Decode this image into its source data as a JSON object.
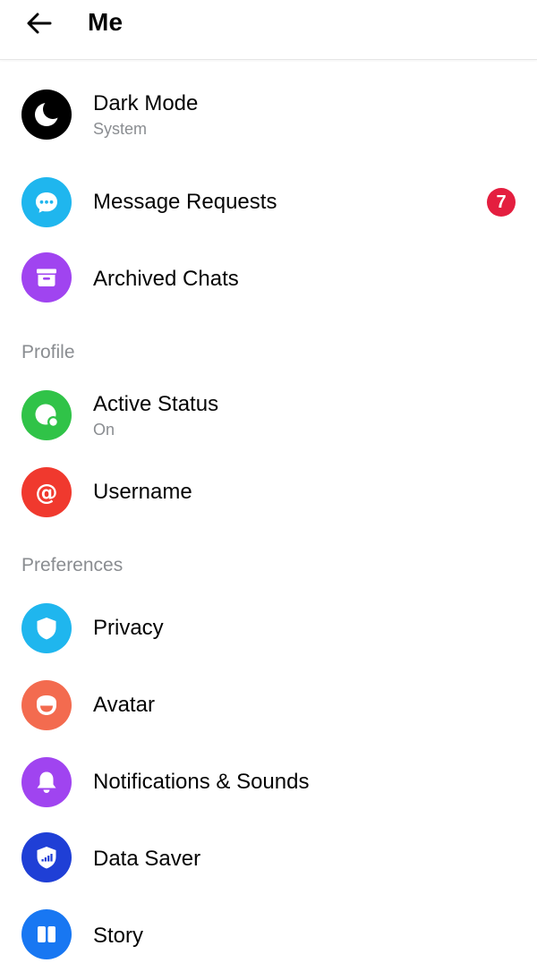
{
  "header": {
    "title": "Me",
    "back_icon": "back-arrow-icon"
  },
  "top_items": [
    {
      "label": "Dark Mode",
      "subtitle": "System",
      "icon": "moon-icon",
      "color": "#000000"
    },
    {
      "label": "Message Requests",
      "badge": "7",
      "icon": "chat-bubble-icon",
      "color": "#1fb6ee"
    },
    {
      "label": "Archived Chats",
      "icon": "archive-box-icon",
      "color": "#a044f0"
    }
  ],
  "profile": {
    "header": "Profile",
    "items": [
      {
        "label": "Active Status",
        "subtitle": "On",
        "icon": "active-status-icon",
        "color": "#30c348"
      },
      {
        "label": "Username",
        "icon": "at-sign-icon",
        "color": "#f0392e"
      }
    ]
  },
  "preferences": {
    "header": "Preferences",
    "items": [
      {
        "label": "Privacy",
        "icon": "shield-icon",
        "color": "#1fb6ee"
      },
      {
        "label": "Avatar",
        "icon": "avatar-face-icon",
        "color": "#f36b4f"
      },
      {
        "label": "Notifications & Sounds",
        "icon": "bell-icon",
        "color": "#a044f0"
      },
      {
        "label": "Data Saver",
        "icon": "data-saver-shield-icon",
        "color": "#1f3fd6"
      },
      {
        "label": "Story",
        "icon": "story-icon",
        "color": "#1877f2"
      }
    ]
  },
  "badge_color": "#e41e3f"
}
